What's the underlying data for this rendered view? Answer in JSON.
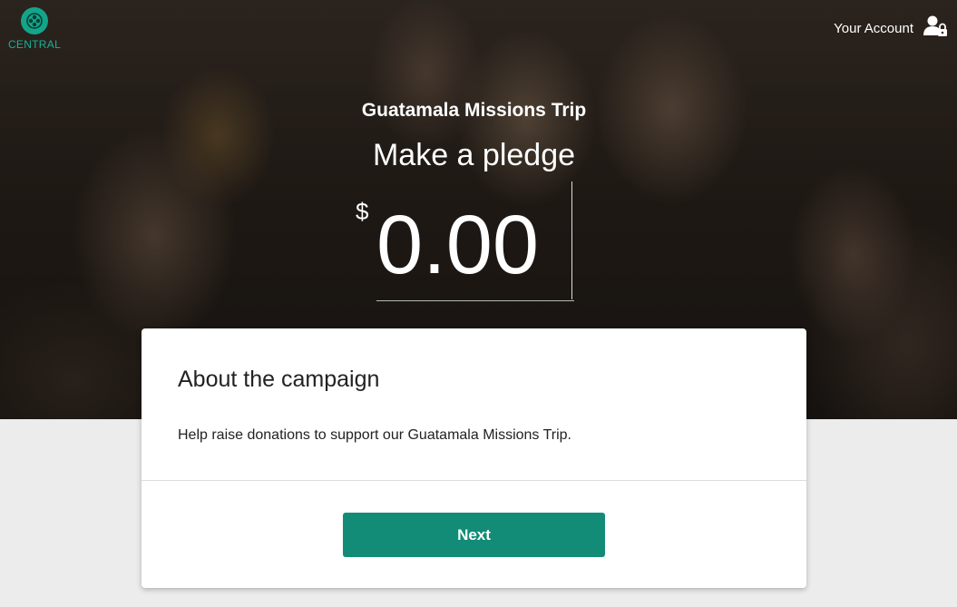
{
  "logo": {
    "text": "CENTRAL",
    "icon": "cross-circle-icon"
  },
  "header": {
    "account_label": "Your Account",
    "account_icon": "user-lock-icon"
  },
  "campaign": {
    "title": "Guatamala Missions Trip"
  },
  "pledge": {
    "heading": "Make a pledge",
    "currency_symbol": "$",
    "amount_placeholder": "0.00"
  },
  "card": {
    "heading": "About the campaign",
    "description": "Help raise donations to support our Guatamala Missions Trip.",
    "next_label": "Next"
  },
  "colors": {
    "accent": "#128c76",
    "logo": "#12a58a"
  }
}
